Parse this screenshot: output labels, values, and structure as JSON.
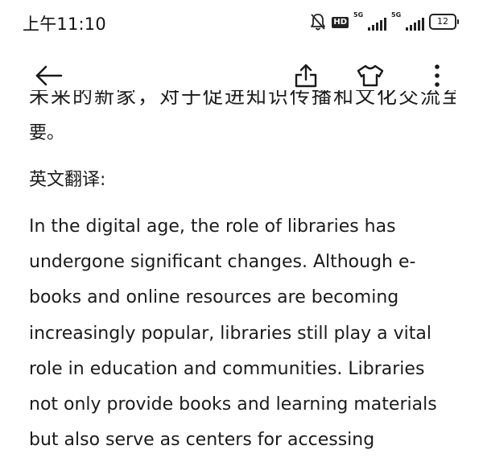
{
  "status_bar": {
    "time": "上午11:10",
    "hd_label": "HD",
    "signal1_label": "5G",
    "signal2_label": "5G",
    "battery_level": "12"
  },
  "toolbar": {
    "back_icon": "arrow-left-icon",
    "share_icon": "share-upload-icon",
    "theme_icon": "t-shirt-icon",
    "more_icon": "more-vertical-icon"
  },
  "article": {
    "cut_off_line": "未来的新家，对于促进知识传播和文化交流至关重",
    "paragraph_end": "要。",
    "english_heading": "英文翻译:",
    "english_lines": [
      "In the digital age, the role of libraries has",
      "undergone significant changes. Although e-",
      "books and online resources are becoming",
      "increasingly popular, libraries still play a vital",
      "role in education and communities. Libraries",
      "not only provide books and learning materials",
      "but also serve as centers for accessing"
    ]
  }
}
